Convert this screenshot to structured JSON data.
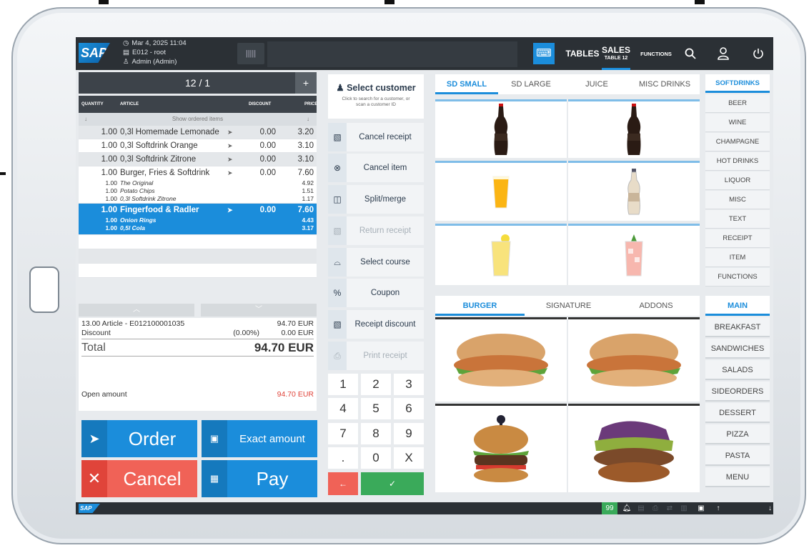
{
  "topbar": {
    "logo": "SAP",
    "datetime": "Mar 4, 2025 11:04",
    "terminal": "E012 - root",
    "user": "Admin (Admin)",
    "tables_label": "TABLES",
    "sales_label": "SALES",
    "sales_sub": "TABLE 12",
    "functions_label": "FUNCTIONS"
  },
  "receipt": {
    "header": "12 / 1",
    "plus": "+",
    "col_quantity": "QUANTITY",
    "col_article": "ARTICLE",
    "col_discount": "DISCOUNT",
    "col_price": "PRICE",
    "show_ordered": "Show ordered items",
    "items": [
      {
        "qty": "1.00",
        "article": "0,3l Homemade Lemonade",
        "discount": "0.00",
        "price": "3.20"
      },
      {
        "qty": "1.00",
        "article": "0,3l Softdrink Orange",
        "discount": "0.00",
        "price": "3.10"
      },
      {
        "qty": "1.00",
        "article": "0,3l Softdrink Zitrone",
        "discount": "0.00",
        "price": "3.10"
      },
      {
        "qty": "1.00",
        "article": "Burger, Fries & Softdrink",
        "discount": "0.00",
        "price": "7.60",
        "subs": [
          {
            "qty": "1.00",
            "article": "The Original",
            "price": "4.92"
          },
          {
            "qty": "1.00",
            "article": "Potato Chips",
            "price": "1.51"
          },
          {
            "qty": "1.00",
            "article": "0,3l Softdrink Zitrone",
            "price": "1.17"
          }
        ]
      },
      {
        "qty": "1.00",
        "article": "Fingerfood & Radler",
        "discount": "0.00",
        "price": "7.60",
        "subs": [
          {
            "qty": "1.00",
            "article": "Onion Rings",
            "price": "4.43"
          },
          {
            "qty": "1.00",
            "article": "0,5l Cola",
            "price": "3.17"
          }
        ]
      }
    ],
    "summary_article": "13.00 Article - E012100001035",
    "summary_article_value": "94.70 EUR",
    "discount_label": "Discount",
    "discount_pct": "(0.00%)",
    "discount_value": "0.00 EUR",
    "total_label": "Total",
    "total_value": "94.70 EUR",
    "open_label": "Open amount",
    "open_value": "94.70 EUR"
  },
  "buttons": {
    "order": "Order",
    "exact": "Exact amount",
    "cancel": "Cancel",
    "pay": "Pay"
  },
  "actions": {
    "select_customer": "Select customer",
    "select_customer_hint": "Click to search for a customer, or scan a customer ID",
    "list": [
      {
        "label": "Cancel receipt",
        "icon": "receipt-cancel-icon",
        "enabled": true
      },
      {
        "label": "Cancel item",
        "icon": "item-cancel-icon",
        "enabled": true
      },
      {
        "label": "Split/merge",
        "icon": "split-icon",
        "enabled": true
      },
      {
        "label": "Return receipt",
        "icon": "return-icon",
        "enabled": false
      },
      {
        "label": "Select course",
        "icon": "course-icon",
        "enabled": true
      },
      {
        "label": "Coupon",
        "icon": "coupon-icon",
        "enabled": true
      },
      {
        "label": "Receipt discount",
        "icon": "discount-icon",
        "enabled": true
      },
      {
        "label": "Print receipt",
        "icon": "print-icon",
        "enabled": false
      }
    ]
  },
  "numpad": {
    "keys": [
      "1",
      "2",
      "3",
      "4",
      "5",
      "6",
      "7",
      "8",
      "9",
      ".",
      "0",
      "X"
    ],
    "back": "←",
    "ok": "✓"
  },
  "drinks": {
    "tabs": [
      "SD SMALL",
      "SD LARGE",
      "JUICE",
      "MISC DRINKS"
    ],
    "active_tab": "SD SMALL",
    "categories": [
      "SOFTDRINKS",
      "BEER",
      "WINE",
      "CHAMPAGNE",
      "HOT DRINKS",
      "LIQUOR",
      "MISC",
      "TEXT",
      "RECEIPT",
      "ITEM",
      "FUNCTIONS"
    ],
    "active_category": "SOFTDRINKS"
  },
  "food": {
    "tabs": [
      "BURGER",
      "SIGNATURE",
      "ADDONS"
    ],
    "active_tab": "BURGER",
    "categories": [
      "MAIN",
      "BREAKFAST",
      "SANDWICHES",
      "SALADS",
      "SIDEORDERS",
      "DESSERT",
      "PIZZA",
      "PASTA",
      "MENU"
    ],
    "active_category": "MAIN"
  },
  "statusbar": {
    "logo": "SAP",
    "count": "99"
  },
  "colors": {
    "accent": "#1b8ddb",
    "order": "#1b8ddb",
    "cancel": "#f06257",
    "ok": "#3aaa5a",
    "dark": "#2b3035"
  }
}
